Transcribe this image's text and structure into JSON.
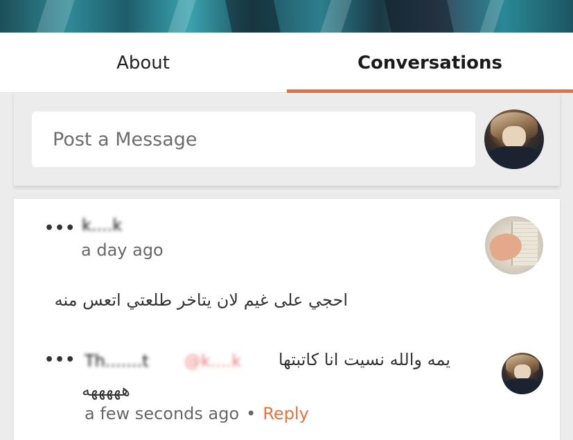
{
  "tabs": [
    {
      "label": "About"
    },
    {
      "label": "Conversations",
      "active": true
    }
  ],
  "post": {
    "placeholder": "Post a Message"
  },
  "comments": [
    {
      "username": "k....k",
      "time": "a day ago",
      "text": "احجي على غيم لان يتاخر طلعتي اتعس منه",
      "reply": {
        "username": "Th.......t",
        "mention": "@k....k",
        "text": "يمه والله نسيت انا كاتبتها",
        "text2": "هههههه",
        "time": "a few seconds ago",
        "reply_label": "Reply",
        "separator": "•"
      }
    }
  ],
  "more_label": "•••",
  "colors": {
    "accent": "#e7703c",
    "background": "#ececec",
    "card": "#ffffff"
  },
  "icons": {
    "more": "more-dots-icon"
  }
}
